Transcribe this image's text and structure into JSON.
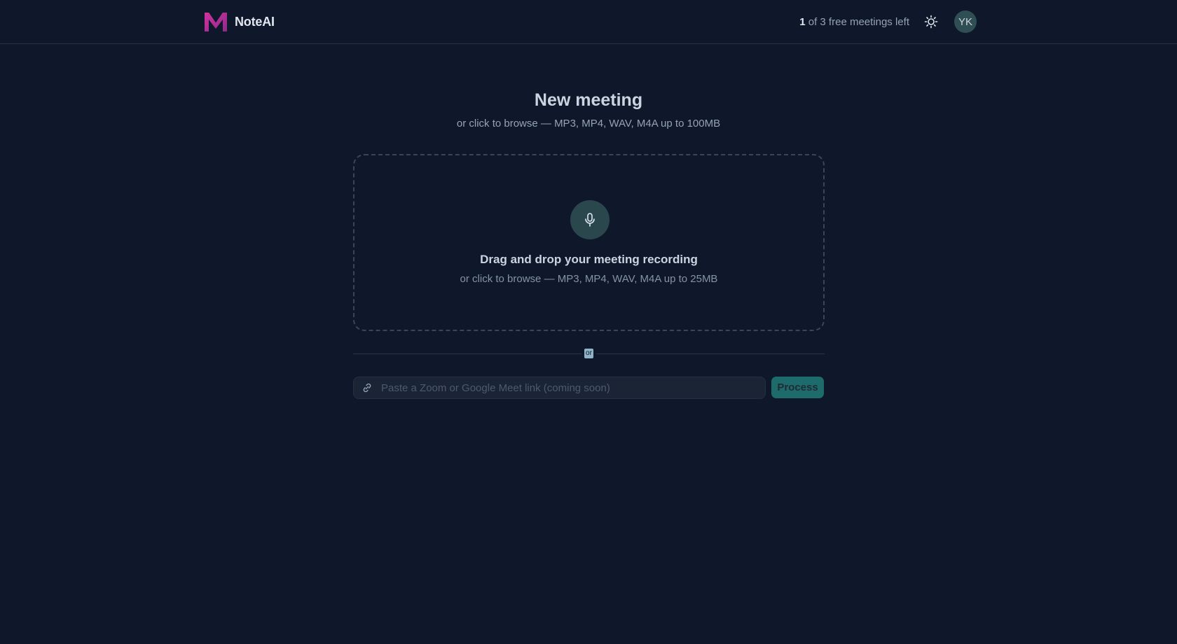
{
  "app": {
    "name": "NoteAI"
  },
  "header": {
    "quota_count": "1",
    "quota_text": " of 3 free meetings left",
    "avatar_initials": "YK"
  },
  "main": {
    "title": "New meeting",
    "subtitle": "or click to browse — MP3, MP4, WAV, M4A up to 100MB"
  },
  "dropzone": {
    "title": "Drag and drop your meeting recording",
    "subtitle": "or click to browse — MP3, MP4, WAV, M4A up to 25MB"
  },
  "divider": {
    "label": "or"
  },
  "link": {
    "placeholder": "Paste a Zoom or Google Meet link (coming soon)",
    "button_label": "Process"
  },
  "icons": {
    "logo": "logo-m-icon",
    "theme": "sun-icon",
    "dropzone": "microphone-icon",
    "link": "link-icon"
  },
  "colors": {
    "background": "#0f172a",
    "accent": "#1e6b6c",
    "logo": "#c026d3"
  }
}
